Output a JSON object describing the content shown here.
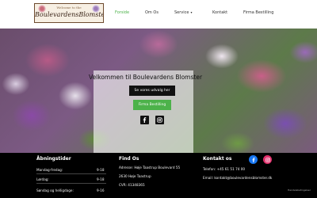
{
  "logo": {
    "tagline": "Welcome to the",
    "name": "BoulevardensBlomster"
  },
  "nav": {
    "items": [
      {
        "label": "Forside",
        "active": true
      },
      {
        "label": "Om Os"
      },
      {
        "label": "Service",
        "has_dropdown": true
      },
      {
        "label": "Kontakt"
      },
      {
        "label": "Firma Bestilling"
      }
    ]
  },
  "hero": {
    "title": "Velkommen til Boulevardens Blomster",
    "primary_button": "Se vores udvalg her",
    "secondary_button": "Firma Bestilling"
  },
  "footer": {
    "hours": {
      "title": "Åbningstider",
      "rows": [
        {
          "day": "Mandag-fredag:",
          "time": "9-18"
        },
        {
          "day": "Lørdag:",
          "time": "9-18"
        },
        {
          "day": "Søndag og helligdage:",
          "time": "9-16"
        }
      ]
    },
    "find": {
      "title": "Find Os",
      "address": "Adresse: Høje Taastrup Boulevard 55",
      "city": "2630 Høje Taastrup",
      "cvr": "CVR: 41348365"
    },
    "contact": {
      "title": "Kontakt os",
      "phone": "Telefon: +45 61 51 74 00",
      "email": "Email: kontakt@boulevardensblomster.dk"
    },
    "credit": "Handelsbetingelser"
  },
  "colors": {
    "accent": "#4cb24a",
    "facebook": "#1877f2",
    "instagram": "#e1306c",
    "dark": "#111111"
  }
}
